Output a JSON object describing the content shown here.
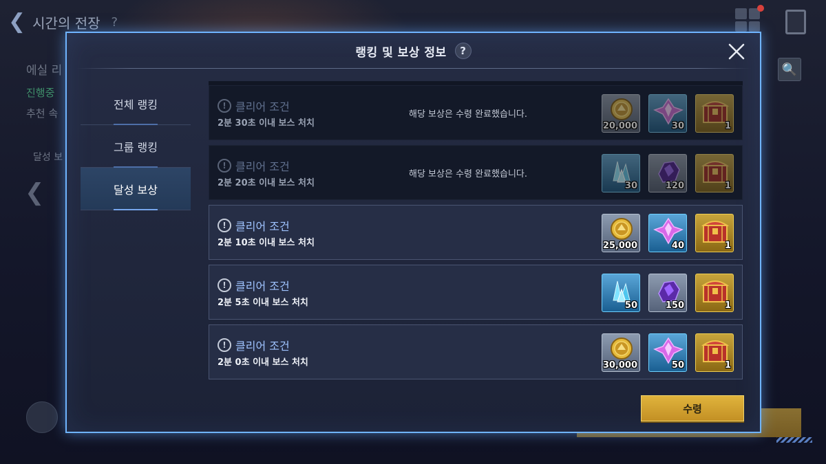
{
  "background": {
    "back_title": "시간의 전장",
    "help_glyph": "?",
    "side_title": "에실 리",
    "side_status": "진행중",
    "side_recommend": "추천 속",
    "side_tab": "달성 보",
    "search_glyph": "🔍"
  },
  "modal": {
    "title": "랭킹 및 보상 정보",
    "help_glyph": "?",
    "tabs": [
      {
        "label": "전체 랭킹",
        "active": false
      },
      {
        "label": "그룹 랭킹",
        "active": false
      },
      {
        "label": "달성 보상",
        "active": true
      }
    ],
    "rewards": [
      {
        "condition_label": "클리어 조건",
        "description": "2분 30초 이내 보스 처치",
        "status": "해당 보상은 수령 완료했습니다.",
        "claimed": true,
        "items": [
          {
            "icon": "gold-coin-icon",
            "frame": "gray",
            "qty": "20,000"
          },
          {
            "icon": "pink-crystal-icon",
            "frame": "blue",
            "qty": "30"
          },
          {
            "icon": "treasure-chest-icon",
            "frame": "gold",
            "qty": "1"
          }
        ]
      },
      {
        "condition_label": "클리어 조건",
        "description": "2분 20초 이내 보스 처치",
        "status": "해당 보상은 수령 완료했습니다.",
        "claimed": true,
        "items": [
          {
            "icon": "blue-shard-icon",
            "frame": "blue",
            "qty": "30"
          },
          {
            "icon": "purple-ore-icon",
            "frame": "gray",
            "qty": "120"
          },
          {
            "icon": "treasure-chest-icon",
            "frame": "gold",
            "qty": "1"
          }
        ]
      },
      {
        "condition_label": "클리어 조건",
        "description": "2분 10초 이내 보스 처치",
        "status": "",
        "claimed": false,
        "items": [
          {
            "icon": "gold-coin-icon",
            "frame": "gray",
            "qty": "25,000"
          },
          {
            "icon": "pink-crystal-icon",
            "frame": "blue",
            "qty": "40"
          },
          {
            "icon": "treasure-chest-icon",
            "frame": "gold",
            "qty": "1"
          }
        ]
      },
      {
        "condition_label": "클리어 조건",
        "description": "2분 5초 이내 보스 처치",
        "status": "",
        "claimed": false,
        "items": [
          {
            "icon": "blue-shard-icon",
            "frame": "blue",
            "qty": "50"
          },
          {
            "icon": "purple-ore-icon",
            "frame": "gray",
            "qty": "150"
          },
          {
            "icon": "treasure-chest-icon",
            "frame": "gold",
            "qty": "1"
          }
        ]
      },
      {
        "condition_label": "클리어 조건",
        "description": "2분 0초 이내 보스 처치",
        "status": "",
        "claimed": false,
        "items": [
          {
            "icon": "gold-coin-icon",
            "frame": "gray",
            "qty": "30,000"
          },
          {
            "icon": "pink-crystal-icon",
            "frame": "blue",
            "qty": "50"
          },
          {
            "icon": "treasure-chest-icon",
            "frame": "gold",
            "qty": "1"
          }
        ]
      }
    ],
    "claim_button": "수령"
  },
  "colors": {
    "modal_border": "#6fb4ff",
    "condition_text": "#9fc3ff",
    "claim_button": "#d4a632"
  }
}
